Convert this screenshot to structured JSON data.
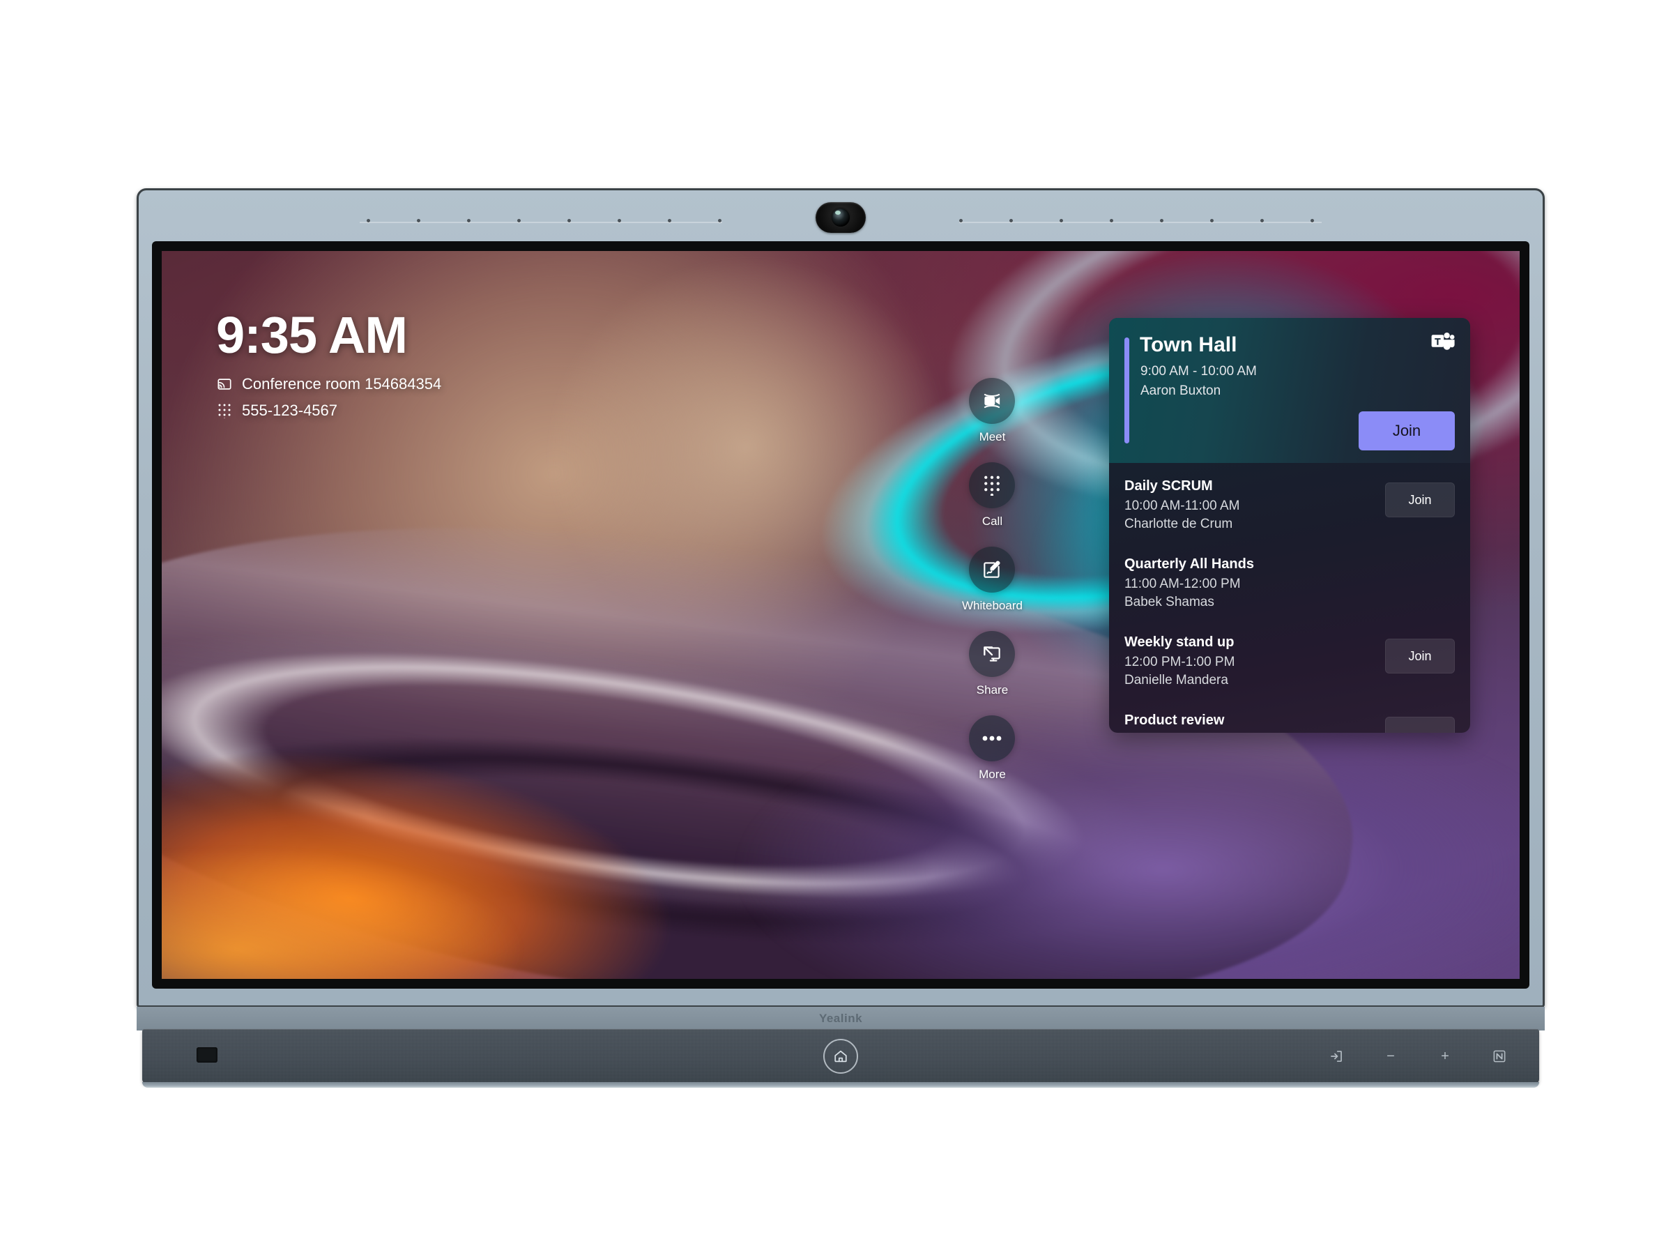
{
  "device": {
    "brand": "Yealink",
    "camera_label": "camera",
    "home_button_label": "home",
    "ir_window_label": "ir-receiver",
    "controls": [
      {
        "name": "input-source",
        "glyph": "input"
      },
      {
        "name": "volume-down",
        "glyph": "−"
      },
      {
        "name": "volume-up",
        "glyph": "+"
      },
      {
        "name": "nfc",
        "glyph": "N"
      }
    ]
  },
  "home": {
    "clock": "9:35 AM",
    "room_name": "Conference room 154684354",
    "phone_number": "555-123-4567",
    "room_icon": "cast-icon",
    "phone_icon": "dialpad-icon"
  },
  "rail": {
    "items": [
      {
        "label": "Meet",
        "icon": "video-camera-icon"
      },
      {
        "label": "Call",
        "icon": "dialpad-icon"
      },
      {
        "label": "Whiteboard",
        "icon": "whiteboard-pen-icon"
      },
      {
        "label": "Share",
        "icon": "screen-share-icon"
      },
      {
        "label": "More",
        "icon": "ellipsis-icon"
      }
    ]
  },
  "panel": {
    "featured": {
      "title": "Town Hall",
      "time": "9:00 AM - 10:00 AM",
      "organizer": "Aaron Buxton",
      "join_label": "Join",
      "provider_icon": "microsoft-teams-icon",
      "accent_color": "#8b8cf7"
    },
    "meetings": [
      {
        "title": "Daily SCRUM",
        "time": "10:00 AM-11:00 AM",
        "organizer": "Charlotte de Crum",
        "join_label": "Join",
        "has_join": true,
        "clipped": false
      },
      {
        "title": "Quarterly All Hands",
        "time": "11:00 AM-12:00 PM",
        "organizer": "Babek Shamas",
        "join_label": "",
        "has_join": false,
        "clipped": false
      },
      {
        "title": "Weekly stand up",
        "time": "12:00 PM-1:00 PM",
        "organizer": "Danielle Mandera",
        "join_label": "Join",
        "has_join": true,
        "clipped": false
      },
      {
        "title": "Product review",
        "time": "",
        "organizer": "",
        "join_label": "",
        "has_join": true,
        "clipped": true
      }
    ]
  },
  "colors": {
    "accent_purple": "#8b8cf7",
    "bezel": "#a8b8c4",
    "soundbar": "#434c55",
    "panel_teal": "#0f4b52"
  }
}
